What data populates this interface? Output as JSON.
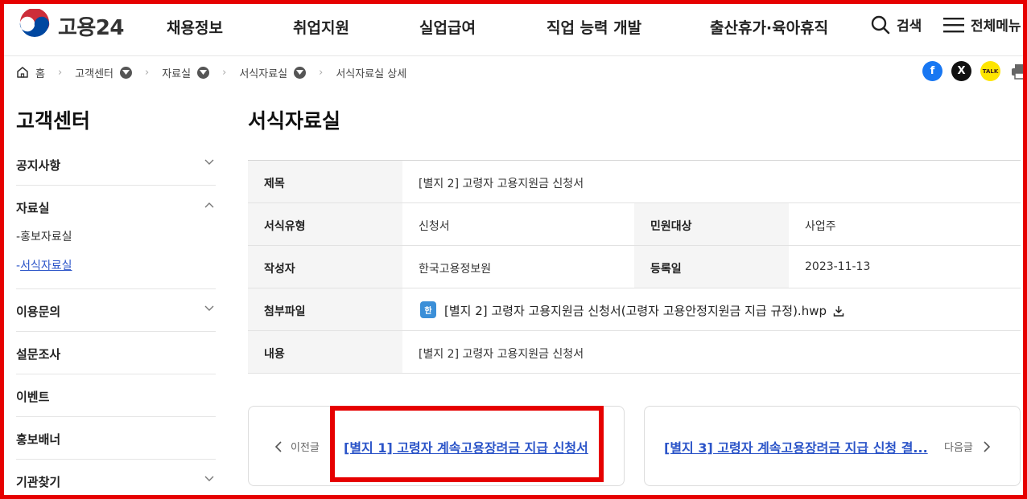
{
  "header": {
    "logo_text": "고용24",
    "nav": [
      "채용정보",
      "취업지원",
      "실업급여",
      "직업 능력 개발",
      "출산휴가·육아휴직"
    ],
    "search_label": "검색",
    "menu_label": "전체메뉴"
  },
  "breadcrumb": {
    "home": "홈",
    "items": [
      "고객센터",
      "자료실",
      "서식자료실"
    ],
    "current": "서식자료실 상세"
  },
  "share": {
    "kakao_label": "TALK"
  },
  "sidebar": {
    "title": "고객센터",
    "items": [
      {
        "label": "공지사항"
      },
      {
        "label": "자료실",
        "subitems": [
          "홍보자료실",
          "서식자료실"
        ]
      },
      {
        "label": "이용문의"
      },
      {
        "label": "설문조사"
      },
      {
        "label": "이벤트"
      },
      {
        "label": "홍보배너"
      },
      {
        "label": "기관찾기"
      }
    ]
  },
  "main": {
    "title": "서식자료실",
    "rows": {
      "title_label": "제목",
      "title_value": "[별지 2] 고령자 고용지원금 신청서",
      "type_label": "서식유형",
      "type_value": "신청서",
      "target_label": "민원대상",
      "target_value": "사업주",
      "author_label": "작성자",
      "author_value": "한국고용정보원",
      "date_label": "등록일",
      "date_value": "2023-11-13",
      "file_label": "첨부파일",
      "file_value": "[별지 2] 고령자 고용지원금 신청서(고령자 고용안정지원금 지급 규정).hwp",
      "file_badge": "한",
      "content_label": "내용",
      "content_value": "[별지 2] 고령자 고용지원금 신청서"
    }
  },
  "pager": {
    "prev_label": "이전글",
    "prev_title": "[별지 1] 고령자 계속고용장려금 지급 신청서",
    "next_label": "다음글",
    "next_title": "[별지 3] 고령자 계속고용장려금 지급 신청 결..."
  },
  "colors": {
    "accent": "#2b54c8",
    "highlight": "#e60000"
  }
}
